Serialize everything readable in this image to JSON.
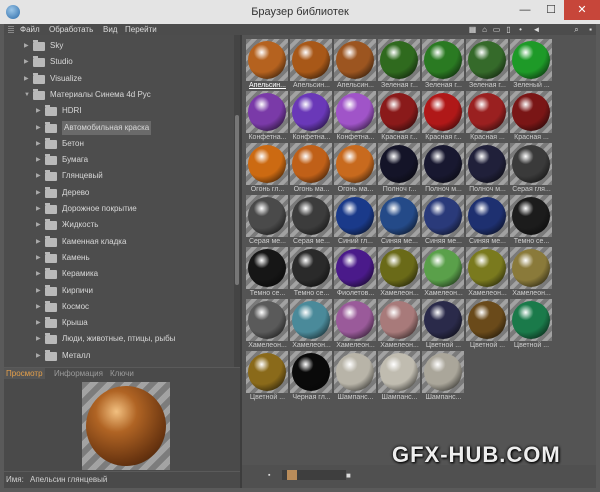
{
  "window": {
    "title": "Браузер библиотек",
    "min": "—",
    "max": "☐",
    "close": "✕"
  },
  "menu": [
    {
      "label": "Файл"
    },
    {
      "label": "Обработать"
    },
    {
      "label": "Вид"
    },
    {
      "label": "Перейти"
    }
  ],
  "toolbar_icons": [
    "view-list-icon",
    "home-icon",
    "folder-icon",
    "book-icon",
    "dot-icon",
    "back-icon",
    "search-icon",
    "pin-icon"
  ],
  "tree": [
    {
      "label": "Sky",
      "depth": 1,
      "expanded": false
    },
    {
      "label": "Studio",
      "depth": 1,
      "expanded": false
    },
    {
      "label": "Visualize",
      "depth": 1,
      "expanded": false
    },
    {
      "label": "Материалы Синема 4d Рус",
      "depth": 1,
      "expanded": true
    },
    {
      "label": "HDRI",
      "depth": 2,
      "expanded": false
    },
    {
      "label": "Автомобильная краска",
      "depth": 2,
      "expanded": false,
      "selected": true
    },
    {
      "label": "Бетон",
      "depth": 2,
      "expanded": false
    },
    {
      "label": "Бумага",
      "depth": 2,
      "expanded": false
    },
    {
      "label": "Глянцевый",
      "depth": 2,
      "expanded": false
    },
    {
      "label": "Дерево",
      "depth": 2,
      "expanded": false
    },
    {
      "label": "Дорожное покрытие",
      "depth": 2,
      "expanded": false
    },
    {
      "label": "Жидкость",
      "depth": 2,
      "expanded": false
    },
    {
      "label": "Каменная кладка",
      "depth": 2,
      "expanded": false
    },
    {
      "label": "Камень",
      "depth": 2,
      "expanded": false
    },
    {
      "label": "Керамика",
      "depth": 2,
      "expanded": false
    },
    {
      "label": "Кирпичи",
      "depth": 2,
      "expanded": false
    },
    {
      "label": "Космос",
      "depth": 2,
      "expanded": false
    },
    {
      "label": "Крыша",
      "depth": 2,
      "expanded": false
    },
    {
      "label": "Люди, животные, птицы, рыбы",
      "depth": 2,
      "expanded": false
    },
    {
      "label": "Металл",
      "depth": 2,
      "expanded": false
    }
  ],
  "tabs": [
    {
      "label": "Просмотр",
      "active": true
    },
    {
      "label": "Информация",
      "active": false
    },
    {
      "label": "Ключи",
      "active": false
    }
  ],
  "preview": {
    "name_label": "Имя:",
    "name_value": "Апельсин глянцевый"
  },
  "materials": [
    {
      "label": "Апельсин...",
      "color": "#b5621f",
      "selected": true
    },
    {
      "label": "Апельсин...",
      "color": "#a85818"
    },
    {
      "label": "Апельсин...",
      "color": "#9c5520"
    },
    {
      "label": "Зеленая г...",
      "color": "#2f6a1e"
    },
    {
      "label": "Зеленая г...",
      "color": "#2a7a22"
    },
    {
      "label": "Зеленая г...",
      "color": "#356a2a"
    },
    {
      "label": "Зеленый ...",
      "color": "#1e9a28"
    },
    {
      "label": "Конфетна...",
      "color": "#7a3aa8"
    },
    {
      "label": "Конфетна...",
      "color": "#6a38b8"
    },
    {
      "label": "Конфетна...",
      "color": "#a054c8"
    },
    {
      "label": "Красная г...",
      "color": "#8a1a1a"
    },
    {
      "label": "Красная г...",
      "color": "#b01818"
    },
    {
      "label": "Красная ...",
      "color": "#9a2020"
    },
    {
      "label": "Красная ...",
      "color": "#7a1616"
    },
    {
      "label": "Огонь гл...",
      "color": "#cc6a12"
    },
    {
      "label": "Огонь ма...",
      "color": "#c06018"
    },
    {
      "label": "Огонь ма...",
      "color": "#c86a1e"
    },
    {
      "label": "Полноч г...",
      "color": "#141428"
    },
    {
      "label": "Полноч м...",
      "color": "#181830"
    },
    {
      "label": "Полноч м...",
      "color": "#20203a"
    },
    {
      "label": "Серая гля...",
      "color": "#3a3a3a"
    },
    {
      "label": "Серая ме...",
      "color": "#4a4a4a"
    },
    {
      "label": "Серая ме...",
      "color": "#3c3c3c"
    },
    {
      "label": "Синий гл...",
      "color": "#1a3a8a"
    },
    {
      "label": "Синяя ме...",
      "color": "#244a88"
    },
    {
      "label": "Синяя ме...",
      "color": "#2a3a7a"
    },
    {
      "label": "Синяя ме...",
      "color": "#1e3070"
    },
    {
      "label": "Темно се...",
      "color": "#1c1c1c"
    },
    {
      "label": "Темно се...",
      "color": "#161616"
    },
    {
      "label": "Темно се...",
      "color": "#2a2a2a"
    },
    {
      "label": "Фиолетов...",
      "color": "#4a1a8a"
    },
    {
      "label": "Хамелеон...",
      "color": "#6a6a18"
    },
    {
      "label": "Хамелеон...",
      "color": "#5aa04a"
    },
    {
      "label": "Хамелеон...",
      "color": "#7a7a1e"
    },
    {
      "label": "Хамелеон...",
      "color": "#8a7a3a"
    },
    {
      "label": "Хамелеон...",
      "color": "#5a5a5a"
    },
    {
      "label": "Хамелеон...",
      "color": "#4a8a9a"
    },
    {
      "label": "Хамелеон...",
      "color": "#9a5a9a"
    },
    {
      "label": "Хамелеон...",
      "color": "#a87a7a"
    },
    {
      "label": "Цветной ...",
      "color": "#2a2a4a"
    },
    {
      "label": "Цветной ...",
      "color": "#6a4a1a"
    },
    {
      "label": "Цветной ...",
      "color": "#1a7a4a"
    },
    {
      "label": "Цветной ...",
      "color": "#8a6a1a"
    },
    {
      "label": "Черная гл...",
      "color": "#0a0a0a"
    },
    {
      "label": "Шампанс...",
      "color": "#b8b4a8"
    },
    {
      "label": "Шампанс...",
      "color": "#c0bcb0"
    },
    {
      "label": "Шампанс...",
      "color": "#aaa69a"
    }
  ],
  "zoom": {
    "small_icon": "▪",
    "large_icon": "■",
    "level": 0.1
  },
  "watermark": "GFX-HUB.COM"
}
